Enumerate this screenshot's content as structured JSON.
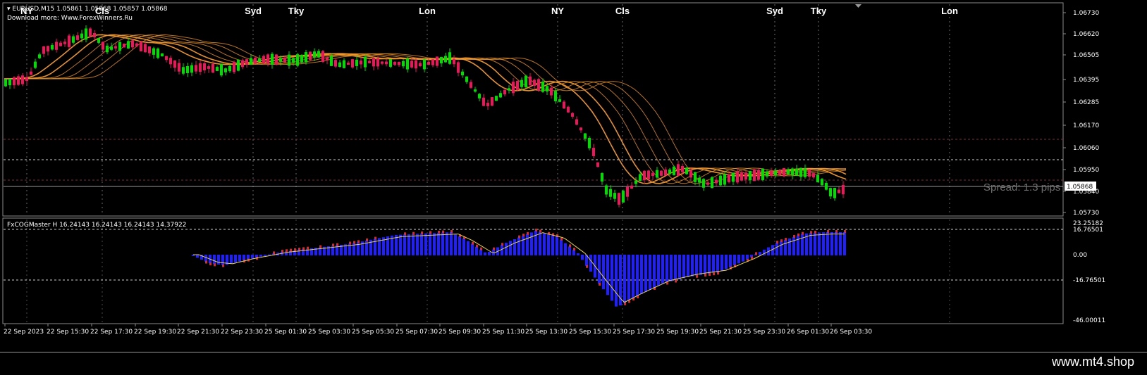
{
  "main": {
    "header_line1": "EURUSD,M15  1.05861 1.05868 1.05857 1.05868",
    "header_line2": "Download more: Www.ForexWinners.Ru",
    "sessions": [
      {
        "label": "NY"
      },
      {
        "label": "Cls"
      },
      {
        "label": "Syd"
      },
      {
        "label": "Tky"
      },
      {
        "label": "Lon"
      },
      {
        "label": "NY"
      },
      {
        "label": "Cls"
      },
      {
        "label": "Syd"
      },
      {
        "label": "Tky"
      },
      {
        "label": "Lon"
      }
    ],
    "price_ticks": [
      "1.06730",
      "1.06620",
      "1.06505",
      "1.06395",
      "1.06285",
      "1.06170",
      "1.06060",
      "1.05950",
      "1.05840",
      "1.05730"
    ],
    "current_price": "1.05868",
    "spread_text": "Spread: 1.3 pips",
    "colors": {
      "bull": "#00dd00",
      "bear": "#e8185a",
      "ma": "#f29a2e"
    }
  },
  "indicator": {
    "header": "FxCOGMaster H 16.24143 16.24143 16.24143 14.37922",
    "ticks": [
      "23.25182",
      "16.76501",
      "0.00",
      "-16.76501",
      "-46.00011"
    ],
    "colors": {
      "pos": "#1f1fff",
      "neg": "#ff1a1a",
      "line": "#e8d44a"
    }
  },
  "time_axis": [
    "22 Sep 2023",
    "22 Sep 15:30",
    "22 Sep 17:30",
    "22 Sep 19:30",
    "22 Sep 21:30",
    "22 Sep 23:30",
    "25 Sep 01:30",
    "25 Sep 03:30",
    "25 Sep 05:30",
    "25 Sep 07:30",
    "25 Sep 09:30",
    "25 Sep 11:30",
    "25 Sep 13:30",
    "25 Sep 15:30",
    "25 Sep 17:30",
    "25 Sep 19:30",
    "25 Sep 21:30",
    "25 Sep 23:30",
    "26 Sep 01:30",
    "26 Sep 03:30"
  ],
  "watermark": "www.mt4.shop"
}
